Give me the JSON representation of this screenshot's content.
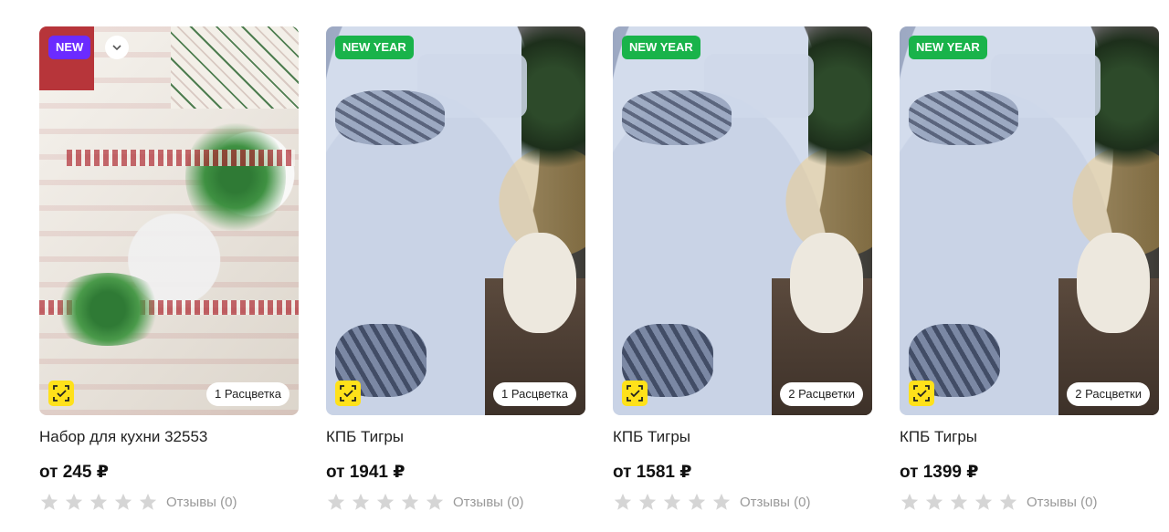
{
  "products": [
    {
      "badge": "NEW",
      "colors_label": "1 Расцветка",
      "title": "Набор для кухни 32553",
      "price": "от 245 ₽",
      "rating": 0,
      "reviews": "Отзывы (0)"
    },
    {
      "badge": "NEW YEAR",
      "colors_label": "1 Расцветка",
      "title": "КПБ Тигры",
      "price": "от 1941 ₽",
      "rating": 0,
      "reviews": "Отзывы (0)"
    },
    {
      "badge": "NEW YEAR",
      "colors_label": "2 Расцветки",
      "title": "КПБ Тигры",
      "price": "от 1581 ₽",
      "rating": 0,
      "reviews": "Отзывы (0)"
    },
    {
      "badge": "NEW YEAR",
      "colors_label": "2 Расцветки",
      "title": "КПБ Тигры",
      "price": "от 1399 ₽",
      "rating": 0,
      "reviews": "Отзывы (0)"
    }
  ],
  "colors": {
    "badge_new": "#6b2bff",
    "badge_new_year": "#19b34a",
    "cube_icon_bg": "#ffe11a",
    "star_empty": "#d5d5d5"
  },
  "icons": {
    "expand": "chevron-down-icon",
    "cube": "3d-view-icon",
    "star": "star-icon"
  }
}
